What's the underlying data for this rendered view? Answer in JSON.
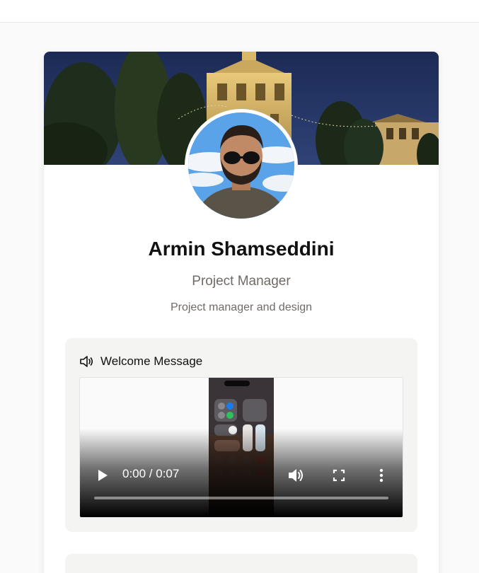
{
  "profile": {
    "name": "Armin Shamseddini",
    "role": "Project Manager",
    "description": "Project manager and design"
  },
  "welcome": {
    "title": "Welcome Message",
    "icon": "speaker-icon"
  },
  "video": {
    "time_display": "0:00 / 0:07",
    "progress": 0,
    "controls": [
      "play-icon",
      "volume-icon",
      "fullscreen-icon",
      "more-icon"
    ]
  },
  "colors": {
    "accent_text": "#6f6a66",
    "panel_bg": "#f4f4f2"
  }
}
